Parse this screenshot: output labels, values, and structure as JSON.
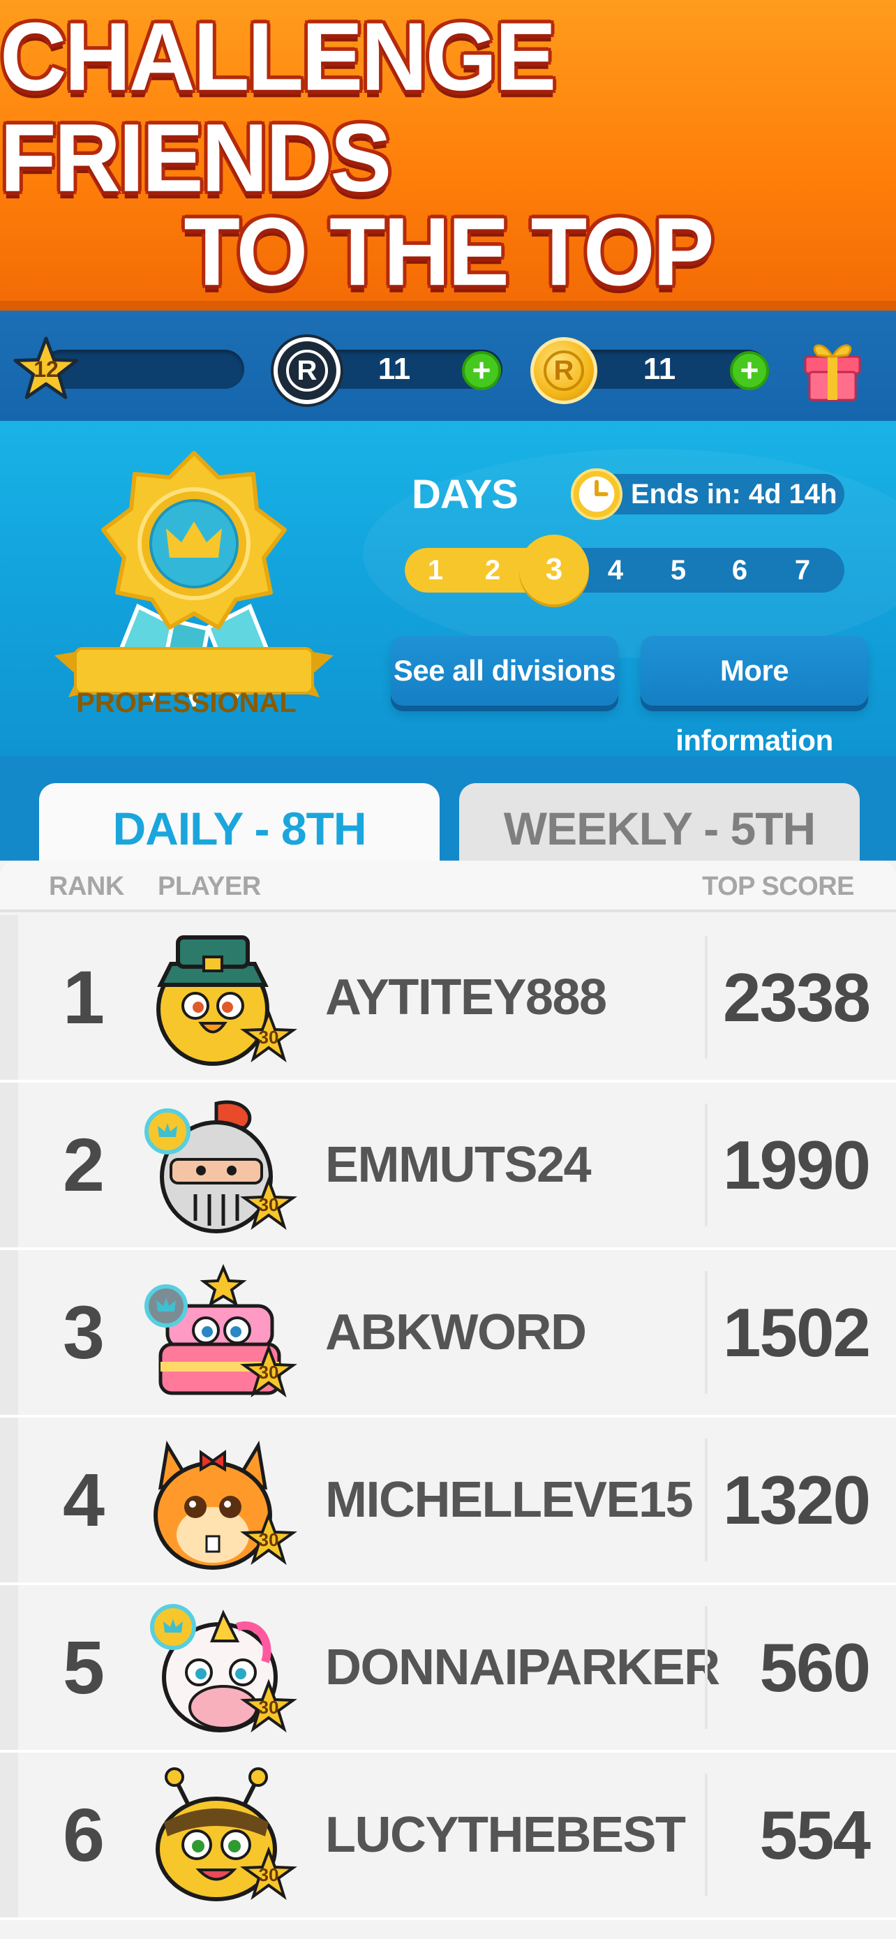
{
  "banner": {
    "line1": "CHALLENGE FRIENDS",
    "line2": "TO THE TOP"
  },
  "currency": {
    "level": "12",
    "chips_icon_letter": "R",
    "chips_count": "11",
    "coins_icon_letter": "R",
    "coins_count": "11",
    "plus": "+"
  },
  "league": {
    "division": "PROFESSIONAL",
    "days_label": "DAYS",
    "ends_in": "Ends in: 4d 14h",
    "days": [
      "1",
      "2",
      "3",
      "4",
      "5",
      "6",
      "7"
    ],
    "current_day": 3,
    "see_divisions": "See all divisions",
    "more_info": "More information"
  },
  "tabs": {
    "daily": "DAILY - 8TH",
    "weekly": "WEEKLY - 5TH"
  },
  "table": {
    "headers": {
      "rank": "RANK",
      "player": "PLAYER",
      "score": "TOP SCORE"
    },
    "rows": [
      {
        "rank": "1",
        "player": "AYTITEY888",
        "score": "2338",
        "level": "30",
        "avatar": "chick-pilgrim-hat-icon"
      },
      {
        "rank": "2",
        "player": "EMMUTS24",
        "score": "1990",
        "level": "30",
        "avatar": "knight-helmet-icon"
      },
      {
        "rank": "3",
        "player": "ABKWORD",
        "score": "1502",
        "level": "30",
        "avatar": "cake-monster-icon"
      },
      {
        "rank": "4",
        "player": "MICHELLEVE15",
        "score": "1320",
        "level": "30",
        "avatar": "hamster-bow-icon"
      },
      {
        "rank": "5",
        "player": "DONNAIPARKER",
        "score": "560",
        "level": "30",
        "avatar": "unicorn-icon"
      },
      {
        "rank": "6",
        "player": "LUCYTHEBEST",
        "score": "554",
        "level": "30",
        "avatar": "bee-icon"
      }
    ]
  },
  "colors": {
    "banner_orange": "#ff8a12",
    "panel_blue": "#12a2dc",
    "active_tab_text": "#1aa6dc",
    "gold": "#f7c62b",
    "plus_green": "#46c91e"
  }
}
